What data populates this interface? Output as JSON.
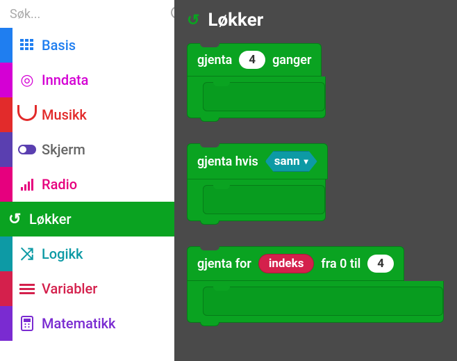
{
  "search": {
    "placeholder": "Søk..."
  },
  "categories": [
    {
      "id": "basis",
      "label": "Basis",
      "color": "#1f7ef0",
      "icon": "grid"
    },
    {
      "id": "inndata",
      "label": "Inndata",
      "color": "#d400d4",
      "icon": "target"
    },
    {
      "id": "musikk",
      "label": "Musikk",
      "color": "#e22b2b",
      "icon": "headphones"
    },
    {
      "id": "skjerm",
      "label": "Skjerm",
      "color": "#5a3fb0",
      "icon": "toggle"
    },
    {
      "id": "radio",
      "label": "Radio",
      "color": "#e6007e",
      "icon": "bars"
    },
    {
      "id": "lokker",
      "label": "Løkker",
      "color": "#0aa321",
      "icon": "reload",
      "selected": true
    },
    {
      "id": "logikk",
      "label": "Logikk",
      "color": "#0d9aa5",
      "icon": "shuffle"
    },
    {
      "id": "variabler",
      "label": "Variabler",
      "color": "#d4204c",
      "icon": "list"
    },
    {
      "id": "matematikk",
      "label": "Matematikk",
      "color": "#7a2bd1",
      "icon": "calc"
    }
  ],
  "flyout": {
    "title": "Løkker",
    "blocks": {
      "repeat_times": {
        "prefix": "gjenta",
        "count": "4",
        "suffix": "ganger"
      },
      "repeat_while": {
        "prefix": "gjenta hvis",
        "condition": "sann"
      },
      "repeat_for": {
        "prefix": "gjenta for",
        "var": "indeks",
        "mid": "fra 0 til",
        "to": "4"
      }
    }
  }
}
